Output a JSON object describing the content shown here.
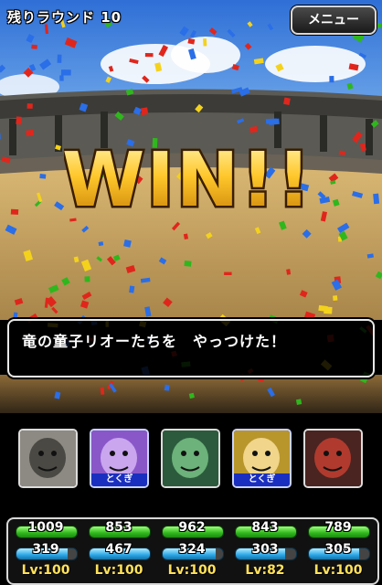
{
  "header": {
    "round_label": "残りラウンド 10",
    "menu_label": "メニュー"
  },
  "banner": {
    "text": "WIN!!"
  },
  "message": {
    "text": "竜の童子リオーたちを　やっつけた！"
  },
  "party": [
    {
      "icon": "skeleton-monster-icon",
      "badge": "",
      "hp": "1009",
      "mp": "319",
      "mp_level": 0.85,
      "level": "Lv:100"
    },
    {
      "icon": "purple-monster-icon",
      "badge": "とくぎ",
      "hp": "853",
      "mp": "467",
      "mp_level": 1.0,
      "level": "Lv:100"
    },
    {
      "icon": "green-dragon-icon",
      "badge": "",
      "hp": "962",
      "mp": "324",
      "mp_level": 0.88,
      "level": "Lv:100"
    },
    {
      "icon": "elf-monster-icon",
      "badge": "とくぎ",
      "hp": "843",
      "mp": "303",
      "mp_level": 0.82,
      "level": "Lv:82"
    },
    {
      "icon": "dark-warrior-icon",
      "badge": "",
      "hp": "789",
      "mp": "305",
      "mp_level": 0.83,
      "level": "Lv:100"
    }
  ],
  "colors": {
    "hp": "#2fb71d",
    "mp": "#2aa5e6",
    "level": "#ffe25a",
    "tokugi": "#1a2fbf"
  }
}
